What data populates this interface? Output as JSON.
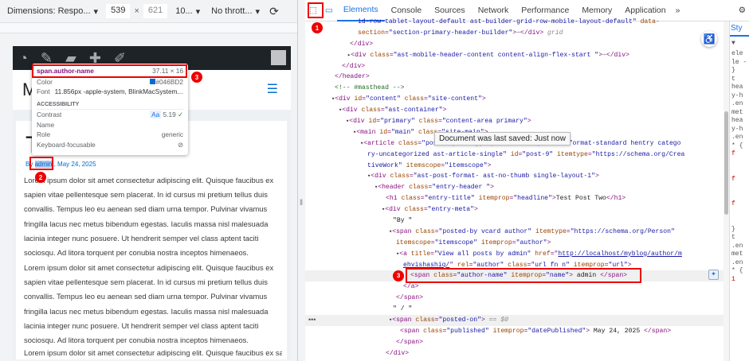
{
  "device_toolbar": {
    "dimensions": "Dimensions: Respo...",
    "width": "539",
    "times": "×",
    "height": "621",
    "zoom": "10...",
    "throttle": "No thrott...",
    "caret": "▾"
  },
  "page": {
    "title": "Te",
    "site_initial": "M",
    "meta_by": "By ",
    "author": "admin",
    "sep": " ,",
    "date": "May 24, 2025",
    "paragraph": "Lorem ipsum dolor sit amet consectetur adipiscing elit. Quisque faucibus ex sapien vitae pellentesque sem placerat. In id cursus mi pretium tellus duis convallis. Tempus leo eu aenean sed diam urna tempor. Pulvinar vivamus fringilla lacus nec metus bibendum egestas. Iaculis massa nisl malesuada lacinia integer nunc posuere. Ut hendrerit semper vel class aptent taciti sociosqu. Ad litora torquent per conubia nostra inceptos himenaeos."
  },
  "inspect_tooltip": {
    "selector": "span.author-name",
    "size": "37.11 × 16",
    "color_label": "Color",
    "color_value": "#046BD2",
    "font_label": "Font",
    "font_value": "11.856px -apple-system, BlinkMacSystem...",
    "section": "ACCESSIBILITY",
    "contrast_label": "Contrast",
    "contrast_aa": "Aa",
    "contrast_value": "5.19",
    "name_label": "Name",
    "role_label": "Role",
    "role_value": "generic",
    "focusable_label": "Keyboard-focusable"
  },
  "badges": [
    "1",
    "2",
    "3",
    "3"
  ],
  "devtools": {
    "tabs": [
      "Elements",
      "Console",
      "Sources",
      "Network",
      "Performance",
      "Memory",
      "Application"
    ],
    "more": "»",
    "styles_tab": "Sty",
    "tooltip": "Document was last saved: Just now",
    "styles_fragments": [
      "ele",
      "le -",
      "}",
      "t",
      "hea",
      "y-h",
      ".en",
      "met",
      "hea",
      "y-h",
      ".en",
      "* {",
      "f",
      "",
      "",
      "f",
      "",
      "",
      "f",
      "",
      "",
      "}",
      "t",
      ".en",
      "met",
      ".en",
      "* {",
      "1"
    ]
  },
  "code_lines": [
    {
      "indent": 66,
      "segs": [
        [
          "av",
          "id-row-tablet-layout-default ast-builder-grid-row-mobile-layout-default\""
        ],
        [
          "at",
          " data-"
        ]
      ]
    },
    {
      "indent": 66,
      "segs": [
        [
          "at",
          "section"
        ],
        [
          "tg",
          "="
        ],
        [
          "av",
          "\"section-primary-header-builder\""
        ],
        [
          "tg",
          ">"
        ],
        [
          "dim",
          "⋯"
        ],
        [
          "tg",
          "</div>"
        ],
        [
          "dim",
          " grid"
        ]
      ]
    },
    {
      "indent": 56,
      "segs": [
        [
          "tg",
          "</div>"
        ]
      ]
    },
    {
      "indent": 53,
      "segs": [
        [
          "ar",
          "▸"
        ],
        [
          "tg",
          "<div "
        ],
        [
          "at",
          "class"
        ],
        [
          "tg",
          "="
        ],
        [
          "av",
          "\"ast-mobile-header-content content-align-flex-start \""
        ],
        [
          "tg",
          ">"
        ],
        [
          "dim",
          "⋯"
        ],
        [
          "tg",
          "</div>"
        ]
      ]
    },
    {
      "indent": 46,
      "segs": [
        [
          "tg",
          "</div>"
        ]
      ]
    },
    {
      "indent": 37,
      "segs": [
        [
          "tg",
          "</header>"
        ]
      ]
    },
    {
      "indent": 37,
      "segs": [
        [
          "cm",
          "<!-- #masthead -->"
        ]
      ]
    },
    {
      "indent": 33,
      "segs": [
        [
          "ar",
          "▾"
        ],
        [
          "tg",
          "<div "
        ],
        [
          "at",
          "id"
        ],
        [
          "tg",
          "="
        ],
        [
          "av",
          "\"content\""
        ],
        [
          "at",
          " class"
        ],
        [
          "tg",
          "="
        ],
        [
          "av",
          "\"site-content\""
        ],
        [
          "tg",
          ">"
        ]
      ]
    },
    {
      "indent": 42,
      "segs": [
        [
          "ar",
          "▾"
        ],
        [
          "tg",
          "<div "
        ],
        [
          "at",
          "class"
        ],
        [
          "tg",
          "="
        ],
        [
          "av",
          "\"ast-container\""
        ],
        [
          "tg",
          ">"
        ]
      ]
    },
    {
      "indent": 51,
      "segs": [
        [
          "ar",
          "▾"
        ],
        [
          "tg",
          "<div "
        ],
        [
          "at",
          "id"
        ],
        [
          "tg",
          "="
        ],
        [
          "av",
          "\"primary\""
        ],
        [
          "at",
          " class"
        ],
        [
          "tg",
          "="
        ],
        [
          "av",
          "\"content-area primary\""
        ],
        [
          "tg",
          ">"
        ]
      ]
    },
    {
      "indent": 60,
      "segs": [
        [
          "ar",
          "▾"
        ],
        [
          "tg",
          "<main "
        ],
        [
          "at",
          "id"
        ],
        [
          "tg",
          "="
        ],
        [
          "av",
          "\"main\""
        ],
        [
          "at",
          " class"
        ],
        [
          "tg",
          "="
        ],
        [
          "av",
          "\"site-main\""
        ],
        [
          "tg",
          ">"
        ]
      ]
    },
    {
      "indent": 69,
      "segs": [
        [
          "ar",
          "▾"
        ],
        [
          "tg",
          "<article "
        ],
        [
          "at",
          "class"
        ],
        [
          "tg",
          "="
        ],
        [
          "av",
          "\"post-9 post type-post status-publish format-standard hentry catego"
        ]
      ]
    },
    {
      "indent": 78,
      "segs": [
        [
          "av",
          "ry-uncategorized ast-article-single\""
        ],
        [
          "at",
          " id"
        ],
        [
          "tg",
          "="
        ],
        [
          "av",
          "\"post-9\""
        ],
        [
          "at",
          " itemtype"
        ],
        [
          "tg",
          "="
        ],
        [
          "av",
          "\"https://schema.org/Crea"
        ]
      ]
    },
    {
      "indent": 78,
      "segs": [
        [
          "av",
          "tiveWork\""
        ],
        [
          "at",
          " itemscope"
        ],
        [
          "tg",
          "="
        ],
        [
          "av",
          "\"itemscope\""
        ],
        [
          "tg",
          ">"
        ]
      ]
    },
    {
      "indent": 78,
      "segs": [
        [
          "ar",
          "▾"
        ],
        [
          "tg",
          "<div "
        ],
        [
          "at",
          "class"
        ],
        [
          "tg",
          "="
        ],
        [
          "av",
          "\"ast-post-format- ast-no-thumb single-layout-1\""
        ],
        [
          "tg",
          ">"
        ]
      ]
    },
    {
      "indent": 87,
      "segs": [
        [
          "ar",
          "▾"
        ],
        [
          "tg",
          "<header "
        ],
        [
          "at",
          "class"
        ],
        [
          "tg",
          "="
        ],
        [
          "av",
          "\"entry-header \""
        ],
        [
          "tg",
          ">"
        ]
      ]
    },
    {
      "indent": 101,
      "segs": [
        [
          "tg",
          "<h1 "
        ],
        [
          "at",
          "class"
        ],
        [
          "tg",
          "="
        ],
        [
          "av",
          "\"entry-title\""
        ],
        [
          "at",
          " itemprop"
        ],
        [
          "tg",
          "="
        ],
        [
          "av",
          "\"headline\""
        ],
        [
          "tg",
          ">"
        ],
        [
          "tx",
          "Test Post Two"
        ],
        [
          "tg",
          "</h1>"
        ]
      ]
    },
    {
      "indent": 96,
      "segs": [
        [
          "ar",
          "▾"
        ],
        [
          "tg",
          "<div "
        ],
        [
          "at",
          "class"
        ],
        [
          "tg",
          "="
        ],
        [
          "av",
          "\"entry-meta\""
        ],
        [
          "tg",
          ">"
        ]
      ]
    },
    {
      "indent": 110,
      "segs": [
        [
          "tx",
          "\"By \""
        ]
      ]
    },
    {
      "indent": 105,
      "segs": [
        [
          "ar",
          "▾"
        ],
        [
          "tg",
          "<span "
        ],
        [
          "at",
          "class"
        ],
        [
          "tg",
          "="
        ],
        [
          "av",
          "\"posted-by vcard author\""
        ],
        [
          "at",
          " itemtype"
        ],
        [
          "tg",
          "="
        ],
        [
          "av",
          "\"https://schema.org/Person\""
        ]
      ]
    },
    {
      "indent": 114,
      "segs": [
        [
          "at",
          "itemscope"
        ],
        [
          "tg",
          "="
        ],
        [
          "av",
          "\"itemscope\""
        ],
        [
          "at",
          " itemprop"
        ],
        [
          "tg",
          "="
        ],
        [
          "av",
          "\"author\""
        ],
        [
          "tg",
          ">"
        ]
      ]
    },
    {
      "indent": 114,
      "segs": [
        [
          "ar",
          "▾"
        ],
        [
          "tg",
          "<a "
        ],
        [
          "at",
          "title"
        ],
        [
          "tg",
          "="
        ],
        [
          "av",
          "\"View all posts by admin\""
        ],
        [
          "at",
          " href"
        ],
        [
          "tg",
          "="
        ],
        [
          "tg",
          "\""
        ],
        [
          "ur",
          "http://localhost/myblog/author/m"
        ]
      ]
    },
    {
      "indent": 123,
      "segs": [
        [
          "ur",
          "ehvishashiq/"
        ],
        [
          "tg",
          "\""
        ],
        [
          "at",
          " rel"
        ],
        [
          "tg",
          "="
        ],
        [
          "av",
          "\"author\""
        ],
        [
          "at",
          " class"
        ],
        [
          "tg",
          "="
        ],
        [
          "av",
          "\"url fn n\""
        ],
        [
          "at",
          " itemprop"
        ],
        [
          "tg",
          "="
        ],
        [
          "av",
          "\"url\""
        ],
        [
          "tg",
          ">"
        ]
      ]
    },
    {
      "indent": 132,
      "hl": true,
      "segs": [
        [
          "tg",
          "<span "
        ],
        [
          "at",
          "class"
        ],
        [
          "tg",
          "="
        ],
        [
          "av",
          "\"author-name\""
        ],
        [
          "at",
          " itemprop"
        ],
        [
          "tg",
          "="
        ],
        [
          "av",
          "\"name\""
        ],
        [
          "tg",
          ">"
        ],
        [
          "tx",
          " admin "
        ],
        [
          "tg",
          "</span>"
        ]
      ]
    },
    {
      "indent": 123,
      "segs": [
        [
          "tg",
          "</a>"
        ]
      ]
    },
    {
      "indent": 114,
      "segs": [
        [
          "tg",
          "</span>"
        ]
      ]
    },
    {
      "indent": 110,
      "segs": [
        [
          "tx",
          "\" / \""
        ]
      ]
    },
    {
      "indent": 105,
      "sel": true,
      "segs": [
        [
          "ar",
          "▾"
        ],
        [
          "tg",
          "<span "
        ],
        [
          "at",
          "class"
        ],
        [
          "tg",
          "="
        ],
        [
          "av",
          "\"posted-on\""
        ],
        [
          "tg",
          ">"
        ],
        [
          "dim",
          " == $0"
        ]
      ]
    },
    {
      "indent": 119,
      "segs": [
        [
          "tg",
          "<span "
        ],
        [
          "at",
          "class"
        ],
        [
          "tg",
          "="
        ],
        [
          "av",
          "\"published\""
        ],
        [
          "at",
          " itemprop"
        ],
        [
          "tg",
          "="
        ],
        [
          "av",
          "\"datePublished\""
        ],
        [
          "tg",
          ">"
        ],
        [
          "tx",
          " May 24, 2025 "
        ],
        [
          "tg",
          "</span>"
        ]
      ]
    },
    {
      "indent": 114,
      "segs": [
        [
          "tg",
          "</span>"
        ]
      ]
    },
    {
      "indent": 101,
      "segs": [
        [
          "tg",
          "</div>"
        ]
      ]
    }
  ]
}
